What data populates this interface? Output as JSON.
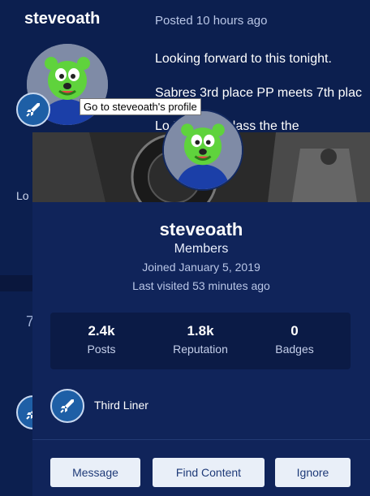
{
  "post": {
    "author": "steveoath",
    "posted": "Posted 10 hours ago",
    "lines": [
      "Looking forward to this tonight.",
      "Sabres 3rd place PP meets 7th plac",
      "Lo                 NT to outclass the the"
    ],
    "left_fragment": "Lo",
    "left_fragment_2": "7"
  },
  "tooltip": "Go to steveoath's profile",
  "card": {
    "name": "steveoath",
    "group": "Members",
    "joined": "Joined January 5, 2019",
    "last_visited": "Last visited 53 minutes ago",
    "stats": [
      {
        "value": "2.4k",
        "label": "Posts"
      },
      {
        "value": "1.8k",
        "label": "Reputation"
      },
      {
        "value": "0",
        "label": "Badges"
      }
    ],
    "rank": "Third Liner",
    "buttons": {
      "message": "Message",
      "find_content": "Find Content",
      "ignore": "Ignore"
    }
  },
  "colors": {
    "background": "#0c1f4f",
    "card": "#10245a",
    "badge": "#1e5fa6",
    "button": "#e9eff8",
    "button_text": "#1e3a78"
  },
  "icons": [
    "rocket-icon",
    "avatar-gummy-bear"
  ]
}
